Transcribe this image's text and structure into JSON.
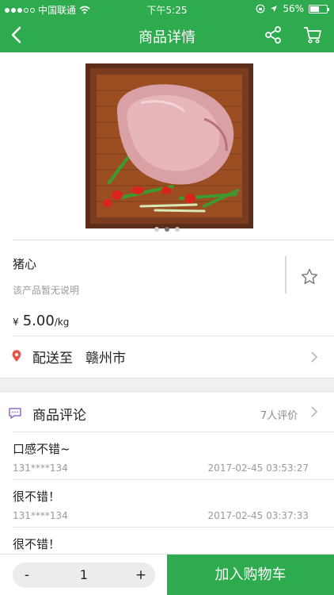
{
  "status_bar": {
    "carrier": "中国联通",
    "time": "下午5:25",
    "battery": "56%",
    "battery_level": 0.56
  },
  "nav": {
    "title": "商品详情",
    "back_icon": "chevron-left-icon",
    "share_icon": "share-icon",
    "cart_icon": "cart-icon"
  },
  "product": {
    "image_icon": "product-photo",
    "carousel_count": 3,
    "carousel_active": 1,
    "name": "猪心",
    "description": "该产品暂无说明",
    "price_symbol": "¥",
    "price_value": "5.00",
    "price_unit": "/kg"
  },
  "delivery": {
    "label": "配送至",
    "city": "赣州市"
  },
  "reviews": {
    "title": "商品评论",
    "count_label": "7人评价",
    "items": [
      {
        "text": "口感不错~",
        "user": "131****134",
        "date": "2017-02-45 03:53:27"
      },
      {
        "text": "很不错！",
        "user": "131****134",
        "date": "2017-02-45 03:37:33"
      },
      {
        "text": "很不错！",
        "user": "",
        "date": ""
      }
    ]
  },
  "bottom_bar": {
    "minus_label": "-",
    "quantity": "1",
    "plus_label": "+",
    "add_to_cart_label": "加入购物车"
  },
  "colors": {
    "brand_green": "#2eaa4f",
    "pin_red": "#e5534b",
    "comment_purple": "#8e6bd0"
  }
}
